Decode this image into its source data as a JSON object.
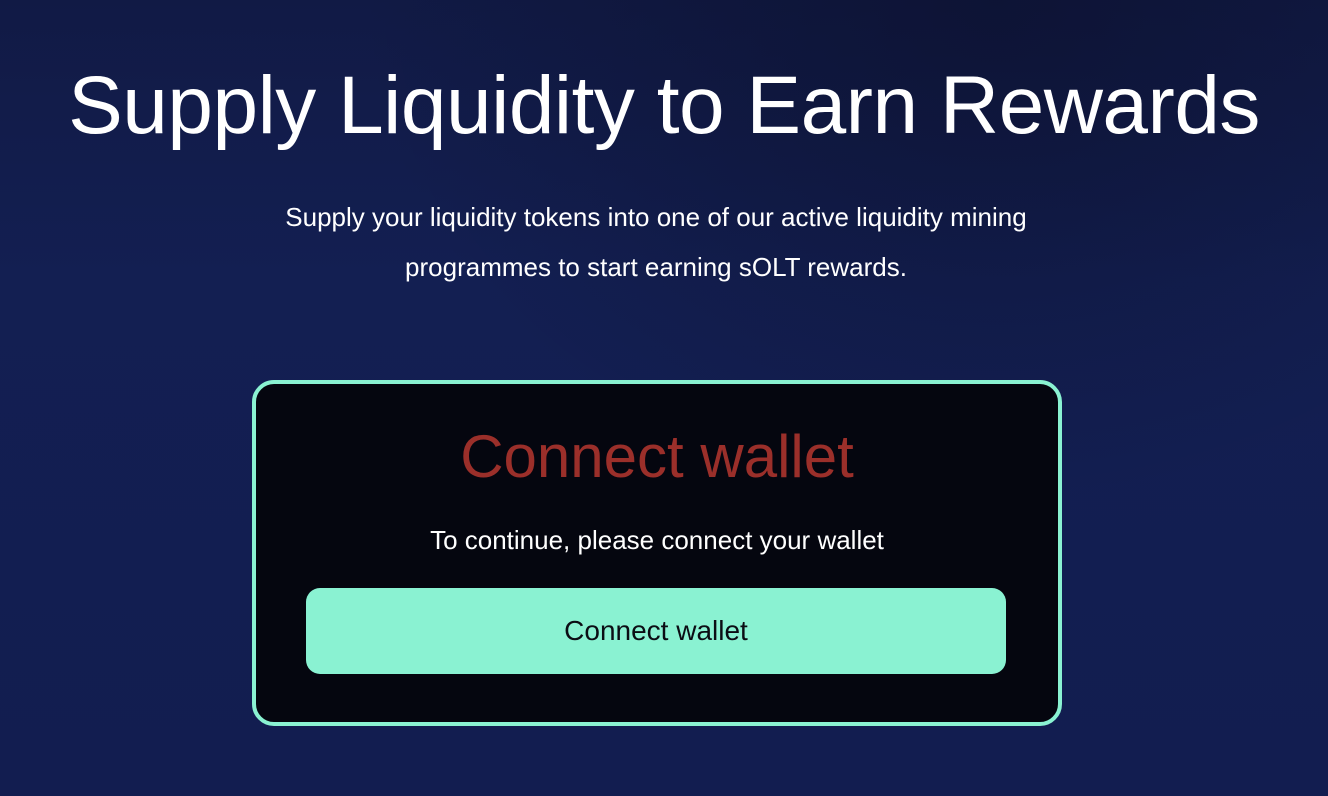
{
  "header": {
    "title": "Supply Liquidity to Earn Rewards",
    "subtitle_line1": "Supply your liquidity tokens into one of our active liquidity mining",
    "subtitle_line2": "programmes to start earning sOLT rewards."
  },
  "wallet_card": {
    "title": "Connect wallet",
    "message": "To continue, please connect your wallet",
    "button_label": "Connect wallet"
  },
  "colors": {
    "background": "#121d50",
    "card_background": "#05060f",
    "accent": "#8af2d2",
    "card_title": "#9b2f2a",
    "text": "#ffffff"
  }
}
